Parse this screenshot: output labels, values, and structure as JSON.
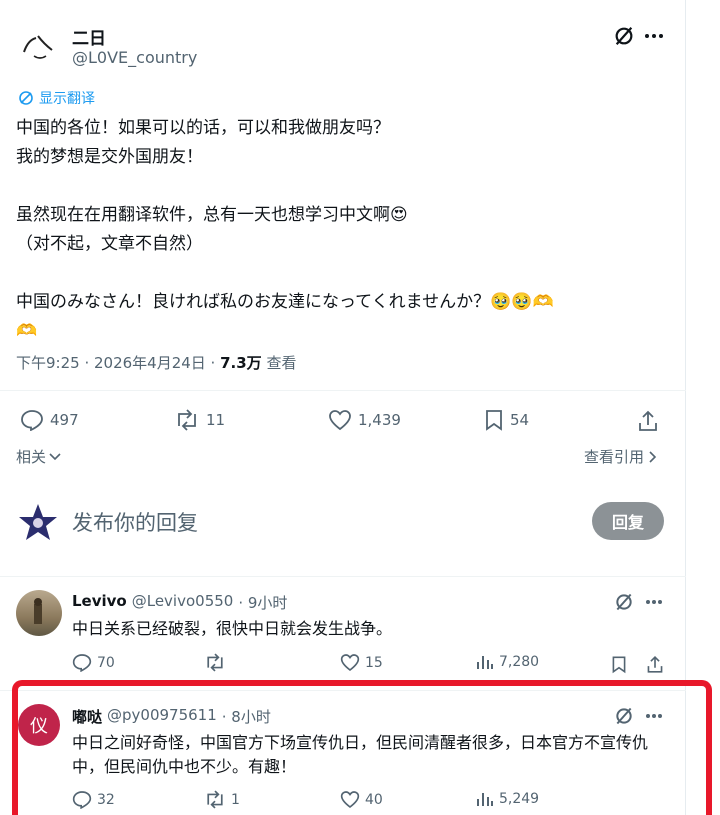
{
  "post": {
    "author_name": "二日",
    "author_handle": "@L0VE_country",
    "translate_label": "显示翻译",
    "lines": [
      "中国的各位！如果可以的话，可以和我做朋友吗？",
      "我的梦想是交外国朋友！",
      "",
      "虽然现在在用翻译软件，总有一天也想学习中文啊😍",
      "（对不起，文章不自然）",
      "",
      "中国のみなさん！良ければ私のお友達になってくれませんか？🥹🥹🫶",
      "🫶"
    ],
    "meta_time": "下午9:25 · 2026年4月24日 · ",
    "meta_views": "7.3万",
    "meta_views_label": " 查看",
    "stats": {
      "replies": "497",
      "reposts": "11",
      "likes": "1,439",
      "bookmarks": "54"
    },
    "related_label": "相关",
    "quotes_label": "查看引用"
  },
  "compose": {
    "placeholder": "发布你的回复",
    "reply_button": "回复"
  },
  "replies": [
    {
      "name": "Levivo",
      "handle": "@Levivo0550",
      "time": "· 9小时",
      "text": "中日关系已经破裂，很快中日就会发生战争。",
      "replies": "70",
      "reposts": "",
      "likes": "15",
      "views": "7,280"
    },
    {
      "name": "嘟哒",
      "handle": "@py00975611",
      "time": "· 8小时",
      "avatar_char": "仪",
      "text": "中日之间好奇怪，中国官方下场宣传仇日，但民间清醒者很多，日本官方不宣传仇中，但民间仇中也不少。有趣！",
      "replies": "32",
      "reposts": "1",
      "likes": "40",
      "views": "5,249"
    }
  ],
  "colors": {
    "accent": "#1d9bf0",
    "highlight": "#e8182a",
    "muted": "#536471"
  }
}
